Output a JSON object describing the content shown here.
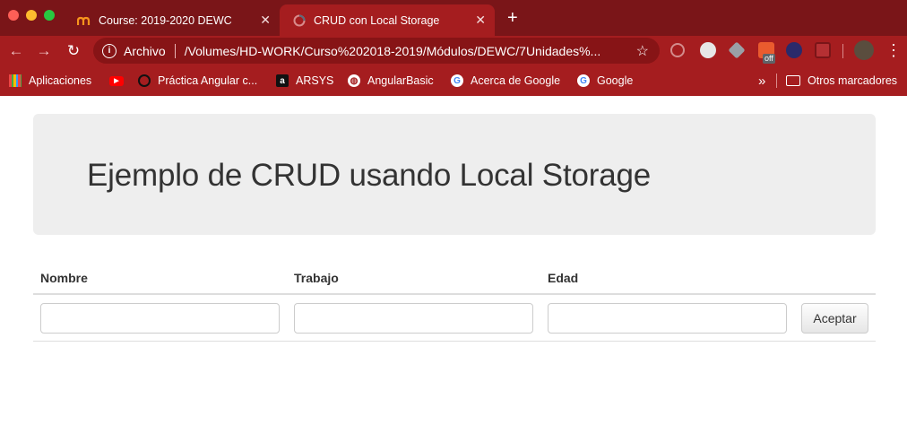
{
  "browser": {
    "tabs": [
      {
        "title": "Course: 2019-2020 DEWC",
        "favicon": "moodle-icon"
      },
      {
        "title": "CRUD con Local Storage",
        "favicon": "loading-spinner-icon"
      }
    ],
    "address": {
      "scheme_label": "Archivo",
      "url": "/Volumes/HD-WORK/Curso%202018-2019/Módulos/DEWC/7Unidades%..."
    },
    "extension_badge": "off",
    "bookmarks": [
      {
        "label": "Aplicaciones",
        "icon": "apps-grid-icon"
      },
      {
        "label": "",
        "icon": "youtube-icon"
      },
      {
        "label": "Práctica Angular c...",
        "icon": "bookmark-logo-icon"
      },
      {
        "label": "ARSYS",
        "icon": "arsys-icon"
      },
      {
        "label": "AngularBasic",
        "icon": "globe-icon"
      },
      {
        "label": "Acerca de Google",
        "icon": "google-icon"
      },
      {
        "label": "Google",
        "icon": "google-icon"
      }
    ],
    "overflow_label": "»",
    "other_bookmarks": "Otros marcadores"
  },
  "page": {
    "title": "Ejemplo de CRUD usando Local Storage",
    "table": {
      "headers": [
        "Nombre",
        "Trabajo",
        "Edad"
      ],
      "inputs": {
        "nombre": "",
        "trabajo": "",
        "edad": ""
      },
      "submit_label": "Aceptar"
    }
  },
  "colors": {
    "chrome_tabstrip": "#7a1518",
    "chrome_toolbar": "#a51d1f",
    "jumbotron_bg": "#eeeeee"
  }
}
